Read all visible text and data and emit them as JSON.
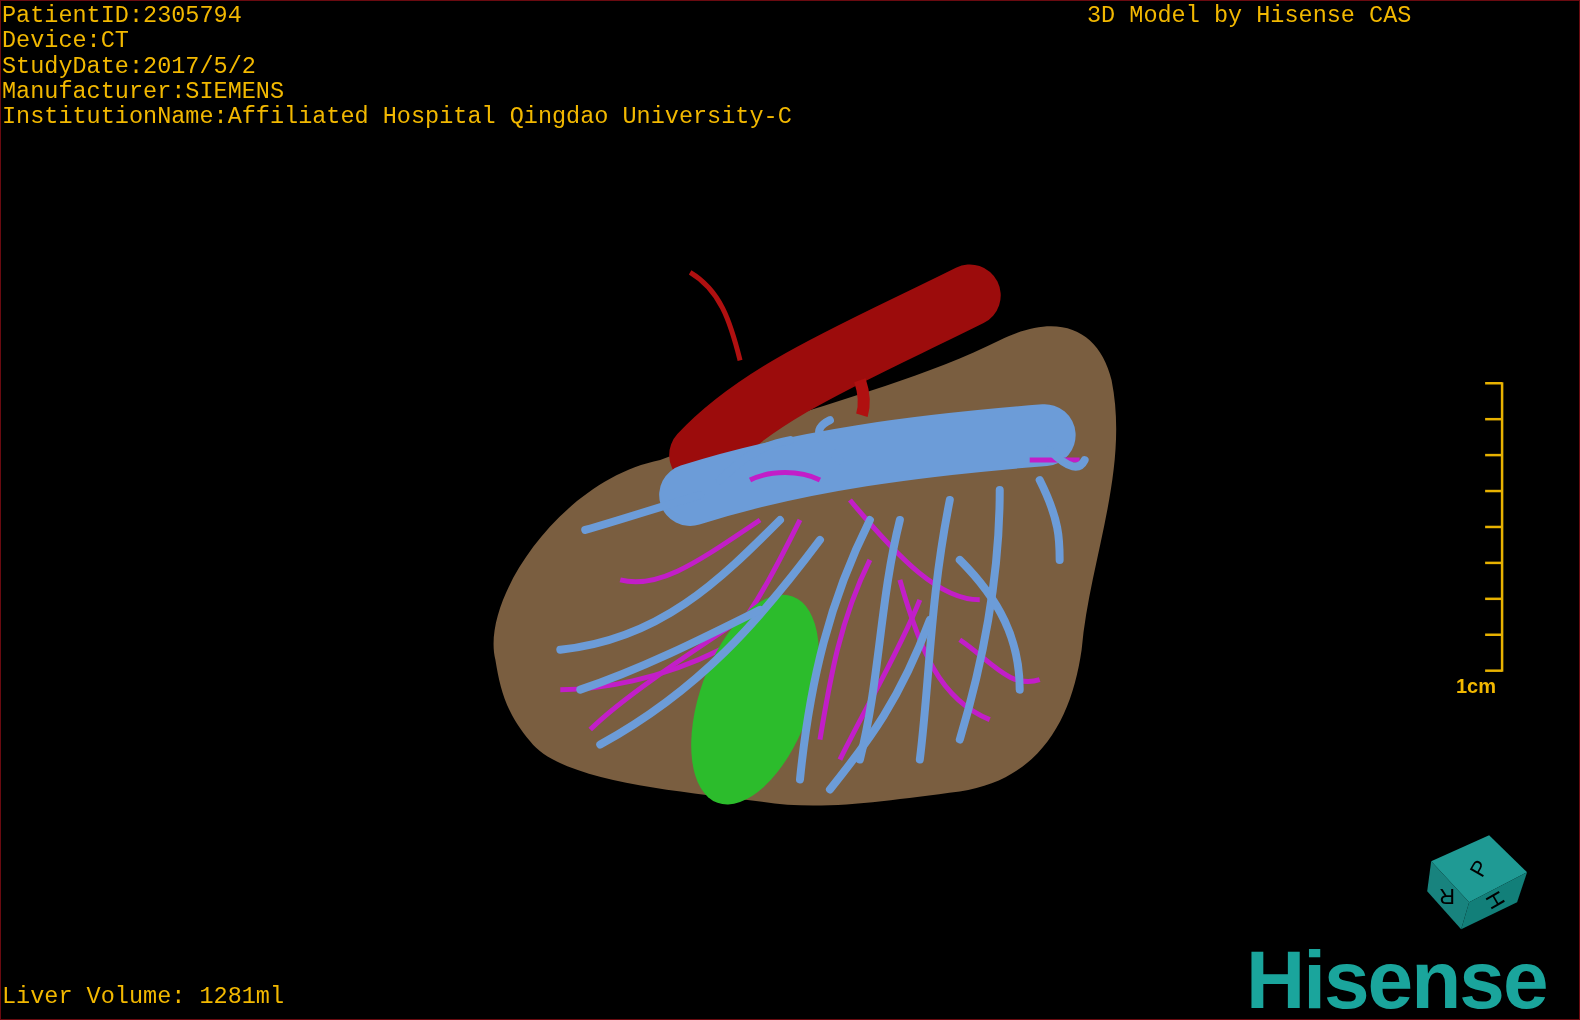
{
  "study_info": [
    "PatientID:2305794",
    "Device:CT",
    "StudyDate:2017/5/2",
    "Manufacturer:SIEMENS",
    "InstitutionName:Affiliated Hospital Qingdao University-C"
  ],
  "title": "3D Model by Hisense CAS",
  "scale_bar": {
    "label": "1cm"
  },
  "orientation_cube": {
    "faces": [
      "P",
      "H",
      "R"
    ]
  },
  "logo": "Hisense",
  "liver_volume": "Liver Volume: 1281ml"
}
